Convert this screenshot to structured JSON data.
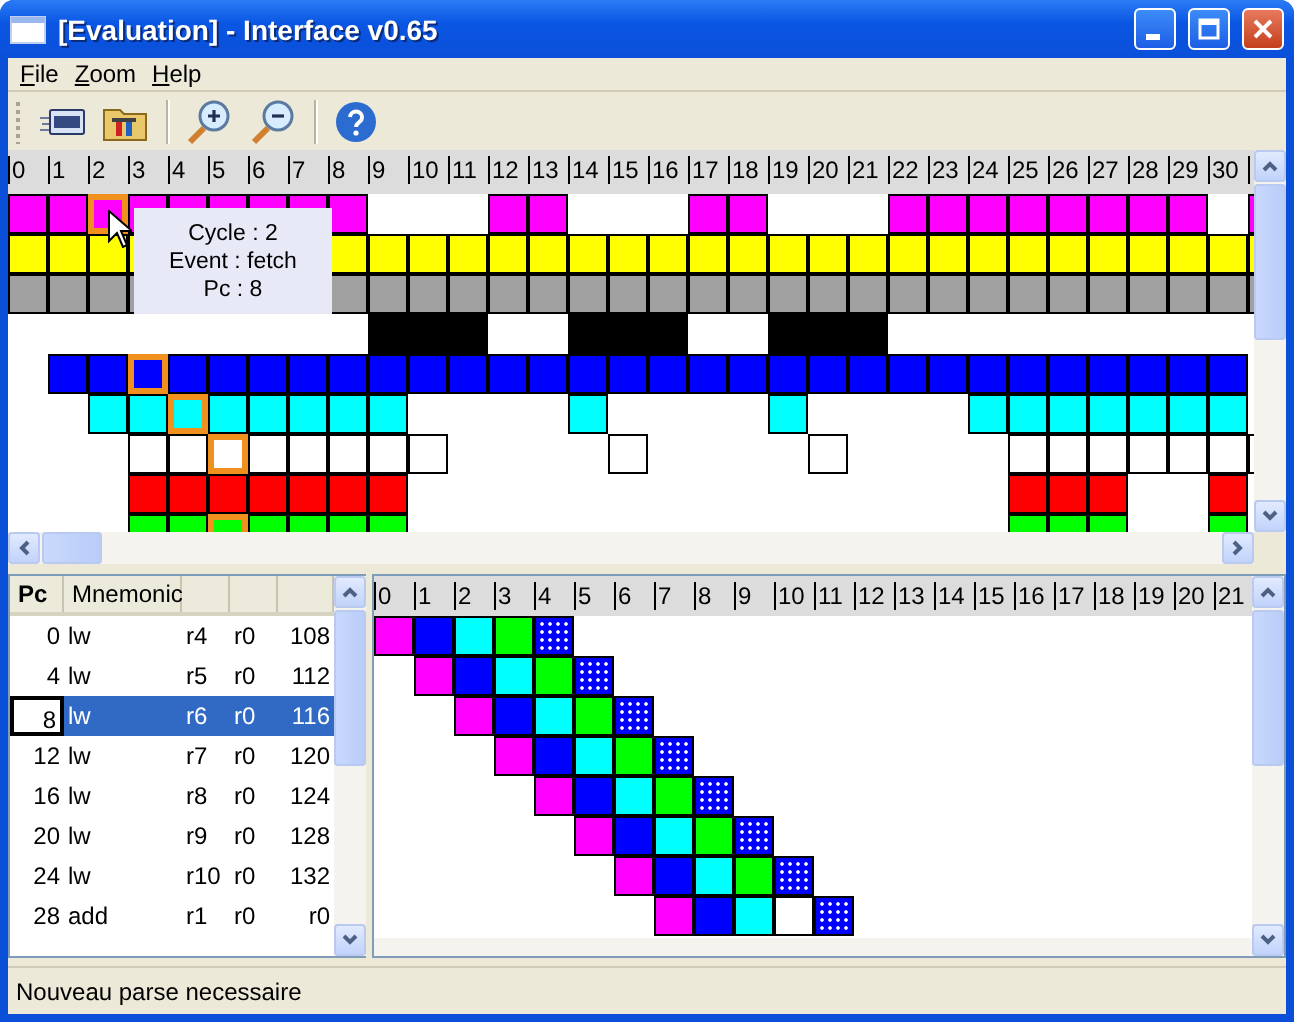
{
  "window": {
    "title": "[Evaluation] - Interface v0.65"
  },
  "menu": [
    {
      "label": "File"
    },
    {
      "label": "Zoom"
    },
    {
      "label": "Help"
    }
  ],
  "timeline": {
    "ticks": [
      "0",
      "1",
      "2",
      "3",
      "4",
      "5",
      "6",
      "7",
      "8",
      "9",
      "10",
      "11",
      "12",
      "13",
      "14",
      "15",
      "16",
      "17",
      "18",
      "19",
      "20",
      "21",
      "22",
      "23",
      "24",
      "25",
      "26",
      "27",
      "28",
      "29",
      "30"
    ],
    "rows": [
      {
        "cells": [
          {
            "kind": "solid",
            "color": "#ff00ff",
            "highlighted": false
          },
          {
            "kind": "solid",
            "color": "#ff00ff",
            "highlighted": false
          },
          {
            "kind": "solid",
            "color": "#ff00ff",
            "highlighted": true
          },
          {
            "kind": "solid",
            "color": "#ff00ff",
            "highlighted": false
          },
          {
            "kind": "solid",
            "color": "#ff00ff",
            "highlighted": false
          },
          {
            "kind": "solid",
            "color": "#ff00ff",
            "highlighted": false
          },
          {
            "kind": "solid",
            "color": "#ff00ff",
            "highlighted": false
          },
          {
            "kind": "solid",
            "color": "#ff00ff",
            "highlighted": false
          },
          {
            "kind": "solid",
            "color": "#ff00ff",
            "highlighted": false
          },
          {
            "kind": "gap"
          },
          {
            "kind": "gap"
          },
          {
            "kind": "gap"
          },
          {
            "kind": "solid",
            "color": "#ff00ff",
            "highlighted": false
          },
          {
            "kind": "solid",
            "color": "#ff00ff",
            "highlighted": false
          },
          {
            "kind": "gap"
          },
          {
            "kind": "gap"
          },
          {
            "kind": "gap"
          },
          {
            "kind": "solid",
            "color": "#ff00ff",
            "highlighted": false
          },
          {
            "kind": "solid",
            "color": "#ff00ff",
            "highlighted": false
          },
          {
            "kind": "gap"
          },
          {
            "kind": "gap"
          },
          {
            "kind": "gap"
          },
          {
            "kind": "solid",
            "color": "#ff00ff",
            "highlighted": false
          },
          {
            "kind": "solid",
            "color": "#ff00ff",
            "highlighted": false
          },
          {
            "kind": "solid",
            "color": "#ff00ff",
            "highlighted": false
          },
          {
            "kind": "solid",
            "color": "#ff00ff",
            "highlighted": false
          },
          {
            "kind": "solid",
            "color": "#ff00ff",
            "highlighted": false
          },
          {
            "kind": "solid",
            "color": "#ff00ff",
            "highlighted": false
          },
          {
            "kind": "solid",
            "color": "#ff00ff",
            "highlighted": false
          },
          {
            "kind": "solid",
            "color": "#ff00ff",
            "highlighted": false
          },
          {
            "kind": "gap"
          },
          {
            "kind": "solid",
            "color": "#ff00ff",
            "highlighted": false
          }
        ]
      },
      {
        "cells": [
          {
            "kind": "solid",
            "color": "#ffff00",
            "highlighted": false
          },
          {
            "kind": "solid",
            "color": "#ffff00",
            "highlighted": false
          },
          {
            "kind": "solid",
            "color": "#ffff00",
            "highlighted": false
          },
          {
            "kind": "solid",
            "color": "#ffff00",
            "highlighted": false
          },
          {
            "kind": "hidden"
          },
          {
            "kind": "hidden"
          },
          {
            "kind": "hidden"
          },
          {
            "kind": "hidden"
          },
          {
            "kind": "solid",
            "color": "#ffff00",
            "highlighted": false
          },
          {
            "kind": "solid",
            "color": "#ffff00",
            "highlighted": false
          },
          {
            "kind": "solid",
            "color": "#ffff00",
            "highlighted": false
          },
          {
            "kind": "solid",
            "color": "#ffff00",
            "highlighted": false
          },
          {
            "kind": "solid",
            "color": "#ffff00",
            "highlighted": false
          },
          {
            "kind": "solid",
            "color": "#ffff00",
            "highlighted": false
          },
          {
            "kind": "solid",
            "color": "#ffff00",
            "highlighted": false
          },
          {
            "kind": "solid",
            "color": "#ffff00",
            "highlighted": false
          },
          {
            "kind": "solid",
            "color": "#ffff00",
            "highlighted": false
          },
          {
            "kind": "solid",
            "color": "#ffff00",
            "highlighted": false
          },
          {
            "kind": "solid",
            "color": "#ffff00",
            "highlighted": false
          },
          {
            "kind": "solid",
            "color": "#ffff00",
            "highlighted": false
          },
          {
            "kind": "solid",
            "color": "#ffff00",
            "highlighted": false
          },
          {
            "kind": "solid",
            "color": "#ffff00",
            "highlighted": false
          },
          {
            "kind": "solid",
            "color": "#ffff00",
            "highlighted": false
          },
          {
            "kind": "solid",
            "color": "#ffff00",
            "highlighted": false
          },
          {
            "kind": "solid",
            "color": "#ffff00",
            "highlighted": false
          },
          {
            "kind": "solid",
            "color": "#ffff00",
            "highlighted": false
          },
          {
            "kind": "solid",
            "color": "#ffff00",
            "highlighted": false
          },
          {
            "kind": "solid",
            "color": "#ffff00",
            "highlighted": false
          },
          {
            "kind": "solid",
            "color": "#ffff00",
            "highlighted": false
          },
          {
            "kind": "solid",
            "color": "#ffff00",
            "highlighted": false
          },
          {
            "kind": "solid",
            "color": "#ffff00",
            "highlighted": false
          },
          {
            "kind": "solid",
            "color": "#ffff00",
            "highlighted": false
          }
        ]
      },
      {
        "cells": [
          {
            "kind": "solid",
            "color": "#a0a0a0",
            "highlighted": false
          },
          {
            "kind": "solid",
            "color": "#a0a0a0",
            "highlighted": false
          },
          {
            "kind": "solid",
            "color": "#a0a0a0",
            "highlighted": false
          },
          {
            "kind": "solid",
            "color": "#a0a0a0",
            "highlighted": false
          },
          {
            "kind": "hidden"
          },
          {
            "kind": "hidden"
          },
          {
            "kind": "hidden"
          },
          {
            "kind": "hidden"
          },
          {
            "kind": "solid",
            "color": "#a0a0a0",
            "highlighted": false
          },
          {
            "kind": "solid",
            "color": "#a0a0a0",
            "highlighted": false
          },
          {
            "kind": "solid",
            "color": "#a0a0a0",
            "highlighted": false
          },
          {
            "kind": "solid",
            "color": "#a0a0a0",
            "highlighted": false
          },
          {
            "kind": "solid",
            "color": "#a0a0a0",
            "highlighted": false
          },
          {
            "kind": "solid",
            "color": "#a0a0a0",
            "highlighted": false
          },
          {
            "kind": "solid",
            "color": "#a0a0a0",
            "highlighted": false
          },
          {
            "kind": "solid",
            "color": "#a0a0a0",
            "highlighted": false
          },
          {
            "kind": "solid",
            "color": "#a0a0a0",
            "highlighted": false
          },
          {
            "kind": "solid",
            "color": "#a0a0a0",
            "highlighted": false
          },
          {
            "kind": "solid",
            "color": "#a0a0a0",
            "highlighted": false
          },
          {
            "kind": "solid",
            "color": "#a0a0a0",
            "highlighted": false
          },
          {
            "kind": "solid",
            "color": "#a0a0a0",
            "highlighted": false
          },
          {
            "kind": "solid",
            "color": "#a0a0a0",
            "highlighted": false
          },
          {
            "kind": "solid",
            "color": "#a0a0a0",
            "highlighted": false
          },
          {
            "kind": "solid",
            "color": "#a0a0a0",
            "highlighted": false
          },
          {
            "kind": "solid",
            "color": "#a0a0a0",
            "highlighted": false
          },
          {
            "kind": "solid",
            "color": "#a0a0a0",
            "highlighted": false
          },
          {
            "kind": "solid",
            "color": "#a0a0a0",
            "highlighted": false
          },
          {
            "kind": "solid",
            "color": "#a0a0a0",
            "highlighted": false
          },
          {
            "kind": "solid",
            "color": "#a0a0a0",
            "highlighted": false
          },
          {
            "kind": "solid",
            "color": "#a0a0a0",
            "highlighted": false
          },
          {
            "kind": "solid",
            "color": "#a0a0a0",
            "highlighted": false
          },
          {
            "kind": "solid",
            "color": "#a0a0a0",
            "highlighted": false
          }
        ]
      },
      {
        "cells": [
          {
            "kind": "gap"
          },
          {
            "kind": "gap"
          },
          {
            "kind": "gap"
          },
          {
            "kind": "gap"
          },
          {
            "kind": "gap"
          },
          {
            "kind": "gap"
          },
          {
            "kind": "gap"
          },
          {
            "kind": "gap"
          },
          {
            "kind": "gap"
          },
          {
            "kind": "band",
            "color": "#000000"
          },
          {
            "kind": "band",
            "color": "#000000"
          },
          {
            "kind": "band",
            "color": "#000000"
          },
          {
            "kind": "gap"
          },
          {
            "kind": "gap"
          },
          {
            "kind": "band",
            "color": "#000000"
          },
          {
            "kind": "band",
            "color": "#000000"
          },
          {
            "kind": "band",
            "color": "#000000"
          },
          {
            "kind": "gap"
          },
          {
            "kind": "gap"
          },
          {
            "kind": "band",
            "color": "#000000"
          },
          {
            "kind": "band",
            "color": "#000000"
          },
          {
            "kind": "band",
            "color": "#000000"
          }
        ]
      },
      {
        "cells": [
          {
            "kind": "gap"
          },
          {
            "kind": "solid",
            "color": "#0000ff",
            "highlighted": false
          },
          {
            "kind": "solid",
            "color": "#0000ff",
            "highlighted": false
          },
          {
            "kind": "solid",
            "color": "#0000ff",
            "highlighted": true
          },
          {
            "kind": "solid",
            "color": "#0000ff",
            "highlighted": false
          },
          {
            "kind": "solid",
            "color": "#0000ff",
            "highlighted": false
          },
          {
            "kind": "solid",
            "color": "#0000ff",
            "highlighted": false
          },
          {
            "kind": "solid",
            "color": "#0000ff",
            "highlighted": false
          },
          {
            "kind": "solid",
            "color": "#0000ff",
            "highlighted": false
          },
          {
            "kind": "solid",
            "color": "#0000ff",
            "highlighted": false
          },
          {
            "kind": "solid",
            "color": "#0000ff",
            "highlighted": false
          },
          {
            "kind": "solid",
            "color": "#0000ff",
            "highlighted": false
          },
          {
            "kind": "solid",
            "color": "#0000ff",
            "highlighted": false
          },
          {
            "kind": "solid",
            "color": "#0000ff",
            "highlighted": false
          },
          {
            "kind": "solid",
            "color": "#0000ff",
            "highlighted": false
          },
          {
            "kind": "solid",
            "color": "#0000ff",
            "highlighted": false
          },
          {
            "kind": "solid",
            "color": "#0000ff",
            "highlighted": false
          },
          {
            "kind": "solid",
            "color": "#0000ff",
            "highlighted": false
          },
          {
            "kind": "solid",
            "color": "#0000ff",
            "highlighted": false
          },
          {
            "kind": "solid",
            "color": "#0000ff",
            "highlighted": false
          },
          {
            "kind": "solid",
            "color": "#0000ff",
            "highlighted": false
          },
          {
            "kind": "solid",
            "color": "#0000ff",
            "highlighted": false
          },
          {
            "kind": "solid",
            "color": "#0000ff",
            "highlighted": false
          },
          {
            "kind": "solid",
            "color": "#0000ff",
            "highlighted": false
          },
          {
            "kind": "solid",
            "color": "#0000ff",
            "highlighted": false
          },
          {
            "kind": "solid",
            "color": "#0000ff",
            "highlighted": false
          },
          {
            "kind": "solid",
            "color": "#0000ff",
            "highlighted": false
          },
          {
            "kind": "solid",
            "color": "#0000ff",
            "highlighted": false
          },
          {
            "kind": "solid",
            "color": "#0000ff",
            "highlighted": false
          },
          {
            "kind": "solid",
            "color": "#0000ff",
            "highlighted": false
          },
          {
            "kind": "solid",
            "color": "#0000ff",
            "highlighted": false
          }
        ]
      },
      {
        "cells": [
          {
            "kind": "gap"
          },
          {
            "kind": "gap"
          },
          {
            "kind": "solid",
            "color": "#00ffff",
            "highlighted": false
          },
          {
            "kind": "solid",
            "color": "#00ffff",
            "highlighted": false
          },
          {
            "kind": "solid",
            "color": "#00ffff",
            "highlighted": true
          },
          {
            "kind": "solid",
            "color": "#00ffff",
            "highlighted": false
          },
          {
            "kind": "solid",
            "color": "#00ffff",
            "highlighted": false
          },
          {
            "kind": "solid",
            "color": "#00ffff",
            "highlighted": false
          },
          {
            "kind": "solid",
            "color": "#00ffff",
            "highlighted": false
          },
          {
            "kind": "solid",
            "color": "#00ffff",
            "highlighted": false
          },
          {
            "kind": "gap"
          },
          {
            "kind": "gap"
          },
          {
            "kind": "gap"
          },
          {
            "kind": "gap"
          },
          {
            "kind": "solid",
            "color": "#00ffff",
            "highlighted": false
          },
          {
            "kind": "gap"
          },
          {
            "kind": "gap"
          },
          {
            "kind": "gap"
          },
          {
            "kind": "gap"
          },
          {
            "kind": "solid",
            "color": "#00ffff",
            "highlighted": false
          },
          {
            "kind": "gap"
          },
          {
            "kind": "gap"
          },
          {
            "kind": "gap"
          },
          {
            "kind": "gap"
          },
          {
            "kind": "solid",
            "color": "#00ffff",
            "highlighted": false
          },
          {
            "kind": "solid",
            "color": "#00ffff",
            "highlighted": false
          },
          {
            "kind": "solid",
            "color": "#00ffff",
            "highlighted": false
          },
          {
            "kind": "solid",
            "color": "#00ffff",
            "highlighted": false
          },
          {
            "kind": "solid",
            "color": "#00ffff",
            "highlighted": false
          },
          {
            "kind": "solid",
            "color": "#00ffff",
            "highlighted": false
          },
          {
            "kind": "solid",
            "color": "#00ffff",
            "highlighted": false
          }
        ]
      },
      {
        "cells": [
          {
            "kind": "gap"
          },
          {
            "kind": "gap"
          },
          {
            "kind": "gap"
          },
          {
            "kind": "solid",
            "color": "#ffffff",
            "highlighted": false
          },
          {
            "kind": "solid",
            "color": "#ffffff",
            "highlighted": false
          },
          {
            "kind": "solid",
            "color": "#ffffff",
            "highlighted": true
          },
          {
            "kind": "solid",
            "color": "#ffffff",
            "highlighted": false
          },
          {
            "kind": "solid",
            "color": "#ffffff",
            "highlighted": false
          },
          {
            "kind": "solid",
            "color": "#ffffff",
            "highlighted": false
          },
          {
            "kind": "solid",
            "color": "#ffffff",
            "highlighted": false
          },
          {
            "kind": "solid",
            "color": "#ffffff",
            "highlighted": false
          },
          {
            "kind": "gap"
          },
          {
            "kind": "gap"
          },
          {
            "kind": "gap"
          },
          {
            "kind": "gap"
          },
          {
            "kind": "solid",
            "color": "#ffffff",
            "highlighted": false
          },
          {
            "kind": "gap"
          },
          {
            "kind": "gap"
          },
          {
            "kind": "gap"
          },
          {
            "kind": "gap"
          },
          {
            "kind": "solid",
            "color": "#ffffff",
            "highlighted": false
          },
          {
            "kind": "gap"
          },
          {
            "kind": "gap"
          },
          {
            "kind": "gap"
          },
          {
            "kind": "gap"
          },
          {
            "kind": "solid",
            "color": "#ffffff",
            "highlighted": false
          },
          {
            "kind": "solid",
            "color": "#ffffff",
            "highlighted": false
          },
          {
            "kind": "solid",
            "color": "#ffffff",
            "highlighted": false
          },
          {
            "kind": "solid",
            "color": "#ffffff",
            "highlighted": false
          },
          {
            "kind": "solid",
            "color": "#ffffff",
            "highlighted": false
          },
          {
            "kind": "solid",
            "color": "#ffffff",
            "highlighted": false
          },
          {
            "kind": "solid",
            "color": "#ffffff",
            "highlighted": false
          }
        ]
      },
      {
        "cells": [
          {
            "kind": "gap"
          },
          {
            "kind": "gap"
          },
          {
            "kind": "gap"
          },
          {
            "kind": "solid",
            "color": "#ff0000",
            "highlighted": false
          },
          {
            "kind": "solid",
            "color": "#ff0000",
            "highlighted": false
          },
          {
            "kind": "solid",
            "color": "#ff0000",
            "highlighted": false
          },
          {
            "kind": "solid",
            "color": "#ff0000",
            "highlighted": false
          },
          {
            "kind": "solid",
            "color": "#ff0000",
            "highlighted": false
          },
          {
            "kind": "solid",
            "color": "#ff0000",
            "highlighted": false
          },
          {
            "kind": "solid",
            "color": "#ff0000",
            "highlighted": false
          },
          {
            "kind": "gap"
          },
          {
            "kind": "gap"
          },
          {
            "kind": "gap"
          },
          {
            "kind": "gap"
          },
          {
            "kind": "gap"
          },
          {
            "kind": "gap"
          },
          {
            "kind": "gap"
          },
          {
            "kind": "gap"
          },
          {
            "kind": "gap"
          },
          {
            "kind": "gap"
          },
          {
            "kind": "gap"
          },
          {
            "kind": "gap"
          },
          {
            "kind": "gap"
          },
          {
            "kind": "gap"
          },
          {
            "kind": "gap"
          },
          {
            "kind": "solid",
            "color": "#ff0000",
            "highlighted": false
          },
          {
            "kind": "solid",
            "color": "#ff0000",
            "highlighted": false
          },
          {
            "kind": "solid",
            "color": "#ff0000",
            "highlighted": false
          },
          {
            "kind": "gap"
          },
          {
            "kind": "gap"
          },
          {
            "kind": "solid",
            "color": "#ff0000",
            "highlighted": false
          }
        ]
      },
      {
        "cells": [
          {
            "kind": "gap"
          },
          {
            "kind": "gap"
          },
          {
            "kind": "gap"
          },
          {
            "kind": "solid",
            "color": "#00ff00",
            "highlighted": false
          },
          {
            "kind": "solid",
            "color": "#00ff00",
            "highlighted": false
          },
          {
            "kind": "solid",
            "color": "#00ff00",
            "highlighted": true
          },
          {
            "kind": "solid",
            "color": "#00ff00",
            "highlighted": false
          },
          {
            "kind": "solid",
            "color": "#00ff00",
            "highlighted": false
          },
          {
            "kind": "solid",
            "color": "#00ff00",
            "highlighted": false
          },
          {
            "kind": "solid",
            "color": "#00ff00",
            "highlighted": false
          },
          {
            "kind": "gap"
          },
          {
            "kind": "gap"
          },
          {
            "kind": "gap"
          },
          {
            "kind": "gap"
          },
          {
            "kind": "gap"
          },
          {
            "kind": "gap"
          },
          {
            "kind": "gap"
          },
          {
            "kind": "gap"
          },
          {
            "kind": "gap"
          },
          {
            "kind": "gap"
          },
          {
            "kind": "gap"
          },
          {
            "kind": "gap"
          },
          {
            "kind": "gap"
          },
          {
            "kind": "gap"
          },
          {
            "kind": "gap"
          },
          {
            "kind": "solid",
            "color": "#00ff00",
            "highlighted": false
          },
          {
            "kind": "solid",
            "color": "#00ff00",
            "highlighted": false
          },
          {
            "kind": "solid",
            "color": "#00ff00",
            "highlighted": false
          },
          {
            "kind": "gap"
          },
          {
            "kind": "gap"
          },
          {
            "kind": "solid",
            "color": "#00ff00",
            "highlighted": false
          }
        ]
      }
    ],
    "tooltip": [
      "Cycle : 2",
      "Event : fetch",
      "Pc : 8"
    ]
  },
  "program": {
    "columns": [
      {
        "label": "Pc"
      },
      {
        "label": "Mnemonic"
      }
    ],
    "rows": [
      {
        "pc": "0",
        "mnemonic": "lw",
        "column_3": "r4",
        "column_4": "r0",
        "column_5": "108",
        "selected": false
      },
      {
        "pc": "4",
        "mnemonic": "lw",
        "column_3": "r5",
        "column_4": "r0",
        "column_5": "112",
        "selected": false
      },
      {
        "pc": "8",
        "mnemonic": "lw",
        "column_3": "r6",
        "column_4": "r0",
        "column_5": "116",
        "selected": true
      },
      {
        "pc": "12",
        "mnemonic": "lw",
        "column_3": "r7",
        "column_4": "r0",
        "column_5": "120",
        "selected": false
      },
      {
        "pc": "16",
        "mnemonic": "lw",
        "column_3": "r8",
        "column_4": "r0",
        "column_5": "124",
        "selected": false
      },
      {
        "pc": "20",
        "mnemonic": "lw",
        "column_3": "r9",
        "column_4": "r0",
        "column_5": "128",
        "selected": false
      },
      {
        "pc": "24",
        "mnemonic": "lw",
        "column_3": "r10",
        "column_4": "r0",
        "column_5": "132",
        "selected": false
      },
      {
        "pc": "28",
        "mnemonic": "add",
        "column_3": "r1",
        "column_4": "r0",
        "column_5": "r0",
        "selected": false
      }
    ]
  },
  "pipeline": {
    "ticks": [
      "0",
      "1",
      "2",
      "3",
      "4",
      "5",
      "6",
      "7",
      "8",
      "9",
      "10",
      "11",
      "12",
      "13",
      "14",
      "15",
      "16",
      "17",
      "18",
      "19",
      "20",
      "21"
    ],
    "rows": [
      {
        "cells": [
          {
            "kind": "solid",
            "color": "#ff00ff",
            "highlighted": false
          },
          {
            "kind": "solid",
            "color": "#0000ff",
            "highlighted": false
          },
          {
            "kind": "solid",
            "color": "#00ffff",
            "highlighted": false
          },
          {
            "kind": "solid",
            "color": "#00ff00",
            "highlighted": false
          },
          {
            "kind": "dotted",
            "color": "#0000ff",
            "highlighted": false
          }
        ]
      },
      {
        "cells": [
          {
            "kind": "gap"
          },
          {
            "kind": "solid",
            "color": "#ff00ff",
            "highlighted": false
          },
          {
            "kind": "solid",
            "color": "#0000ff",
            "highlighted": false
          },
          {
            "kind": "solid",
            "color": "#00ffff",
            "highlighted": false
          },
          {
            "kind": "solid",
            "color": "#00ff00",
            "highlighted": false
          },
          {
            "kind": "dotted",
            "color": "#0000ff",
            "highlighted": false
          }
        ]
      },
      {
        "cells": [
          {
            "kind": "gap"
          },
          {
            "kind": "gap"
          },
          {
            "kind": "solid",
            "color": "#ff00ff",
            "highlighted": false
          },
          {
            "kind": "solid",
            "color": "#0000ff",
            "highlighted": false
          },
          {
            "kind": "solid",
            "color": "#00ffff",
            "highlighted": false
          },
          {
            "kind": "solid",
            "color": "#00ff00",
            "highlighted": false
          },
          {
            "kind": "dotted",
            "color": "#0000ff",
            "highlighted": false
          }
        ]
      },
      {
        "cells": [
          {
            "kind": "gap"
          },
          {
            "kind": "gap"
          },
          {
            "kind": "gap"
          },
          {
            "kind": "solid",
            "color": "#ff00ff",
            "highlighted": false
          },
          {
            "kind": "solid",
            "color": "#0000ff",
            "highlighted": false
          },
          {
            "kind": "solid",
            "color": "#00ffff",
            "highlighted": false
          },
          {
            "kind": "solid",
            "color": "#00ff00",
            "highlighted": false
          },
          {
            "kind": "dotted",
            "color": "#0000ff",
            "highlighted": false
          }
        ]
      },
      {
        "cells": [
          {
            "kind": "gap"
          },
          {
            "kind": "gap"
          },
          {
            "kind": "gap"
          },
          {
            "kind": "gap"
          },
          {
            "kind": "solid",
            "color": "#ff00ff",
            "highlighted": false
          },
          {
            "kind": "solid",
            "color": "#0000ff",
            "highlighted": false
          },
          {
            "kind": "solid",
            "color": "#00ffff",
            "highlighted": false
          },
          {
            "kind": "solid",
            "color": "#00ff00",
            "highlighted": false
          },
          {
            "kind": "dotted",
            "color": "#0000ff",
            "highlighted": false
          }
        ]
      },
      {
        "cells": [
          {
            "kind": "gap"
          },
          {
            "kind": "gap"
          },
          {
            "kind": "gap"
          },
          {
            "kind": "gap"
          },
          {
            "kind": "gap"
          },
          {
            "kind": "solid",
            "color": "#ff00ff",
            "highlighted": false
          },
          {
            "kind": "solid",
            "color": "#0000ff",
            "highlighted": false
          },
          {
            "kind": "solid",
            "color": "#00ffff",
            "highlighted": false
          },
          {
            "kind": "solid",
            "color": "#00ff00",
            "highlighted": false
          },
          {
            "kind": "dotted",
            "color": "#0000ff",
            "highlighted": false
          }
        ]
      },
      {
        "cells": [
          {
            "kind": "gap"
          },
          {
            "kind": "gap"
          },
          {
            "kind": "gap"
          },
          {
            "kind": "gap"
          },
          {
            "kind": "gap"
          },
          {
            "kind": "gap"
          },
          {
            "kind": "solid",
            "color": "#ff00ff",
            "highlighted": false
          },
          {
            "kind": "solid",
            "color": "#0000ff",
            "highlighted": false
          },
          {
            "kind": "solid",
            "color": "#00ffff",
            "highlighted": false
          },
          {
            "kind": "solid",
            "color": "#00ff00",
            "highlighted": false
          },
          {
            "kind": "dotted",
            "color": "#0000ff",
            "highlighted": false
          }
        ]
      },
      {
        "cells": [
          {
            "kind": "gap"
          },
          {
            "kind": "gap"
          },
          {
            "kind": "gap"
          },
          {
            "kind": "gap"
          },
          {
            "kind": "gap"
          },
          {
            "kind": "gap"
          },
          {
            "kind": "gap"
          },
          {
            "kind": "solid",
            "color": "#ff00ff",
            "highlighted": false
          },
          {
            "kind": "solid",
            "color": "#0000ff",
            "highlighted": false
          },
          {
            "kind": "solid",
            "color": "#00ffff",
            "highlighted": false
          },
          {
            "kind": "solid",
            "color": "#ffffff",
            "highlighted": false
          },
          {
            "kind": "dotted",
            "color": "#0000ff",
            "highlighted": false
          }
        ]
      }
    ]
  },
  "status_bar": "Nouveau parse necessaire"
}
